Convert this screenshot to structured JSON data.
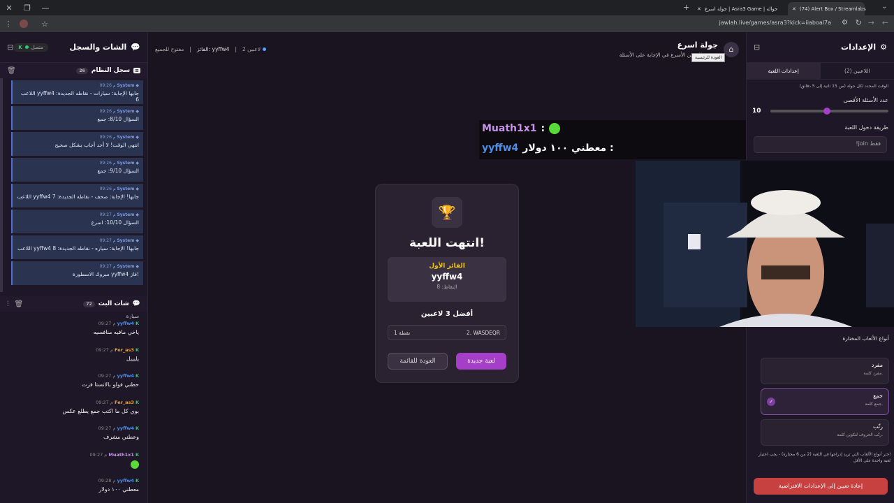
{
  "browser": {
    "tabs": [
      {
        "title": "(74) Alert Box / Streamlabs"
      },
      {
        "title": "جولة اسرع | Asra3 Game | جواله"
      }
    ],
    "url": "jawlah.live/games/asra3?kick=iiaboal7a"
  },
  "chat_panel": {
    "title": "الشات والسجل",
    "status": "متصل",
    "system_log": {
      "title": "سجل النظام",
      "count": "26",
      "items": [
        {
          "sender": "System",
          "time": "09:26 م",
          "text": "اللاعب yyffw4 جابها الإجابة: سيارات - نقاطه الجديدة: 6"
        },
        {
          "sender": "System",
          "time": "09:26 م",
          "text": "السؤال 8/10: جمع"
        },
        {
          "sender": "System",
          "time": "09:26 م",
          "text": "انتهى الوقت! لا أحد أجاب بشكل صحيح"
        },
        {
          "sender": "System",
          "time": "09:26 م",
          "text": "السؤال 9/10: جمع"
        },
        {
          "sender": "System",
          "time": "09:26 م",
          "text": "اللاعب yyffw4 جابها! الإجابة: صحف - نقاطه الجديدة: 7"
        },
        {
          "sender": "System",
          "time": "09:27 م",
          "text": "السؤال 10/10: اسرع"
        },
        {
          "sender": "System",
          "time": "09:27 م",
          "text": "اللاعب yyffw4 جابها! الإجابة: سياره - نقاطه الجديدة: 8"
        },
        {
          "sender": "System",
          "time": "09:27 م",
          "text": "مبروك الاسطورة yyffw4 فاز!"
        }
      ]
    },
    "live_chat": {
      "title": "شات البث",
      "count": "72",
      "top_fragment": "سيارة",
      "messages": [
        {
          "user": "yyffw4",
          "time": "09:27 م",
          "text": "ياخي مافيه منافسيه",
          "color": "#4d8fe8"
        },
        {
          "user": "Fer_as3",
          "time": "09:27 م",
          "text": "يلبيبل",
          "color": "#e8a33a"
        },
        {
          "user": "yyffw4",
          "time": "09:27 م",
          "text": "حطني فولو بالانستا فزت",
          "color": "#4d8fe8"
        },
        {
          "user": "Fer_as3",
          "time": "09:27 م",
          "text": "بوي كل ما اكتب جمع يطلع عكس",
          "color": "#e8a33a"
        },
        {
          "user": "yyffw4",
          "time": "09:27 م",
          "text": "وعطني مشرف",
          "color": "#4d8fe8"
        },
        {
          "user": "Muath1x1",
          "time": "09:27 م",
          "text": "",
          "color": "#c792ea"
        },
        {
          "user": "yyffw4",
          "time": "09:28 م",
          "text": "معطني ١٠٠ دولار",
          "color": "#4d8fe8"
        }
      ]
    }
  },
  "game_header": {
    "title": "جولة اسرع",
    "subtitle": "وتحدي للاعبين الأسرع في الإجابة على الأسئلة",
    "home_tooltip": "العودة للرئيسية",
    "players_count": "2 لاعبين",
    "winner_label": "الفائز: yyffw4",
    "join_status": "مفتوح للجميع"
  },
  "result_card": {
    "title": "انتهت اللعبة!",
    "first_place_label": "الفائز الأول",
    "winner_name": "yyffw4",
    "winner_points": "النقاط: 8",
    "top3_title": "أفضل 3 لاعبين",
    "top3": [
      {
        "rank_name": "2. WASDEQR",
        "points": "1 نقطة"
      }
    ],
    "new_game_button": "لعبة جديدة",
    "back_button": "العودة للقائمة"
  },
  "stream_overlay": {
    "line1_user": "Muath1x1",
    "line2_text": "معطني ١٠٠ دولار :",
    "line2_user": "yyffw4"
  },
  "settings": {
    "title": "الإعدادات",
    "tooltip": "العودة للرئيسية",
    "tabs": [
      "إعدادات اللعبة",
      "اللاعبين (2)"
    ],
    "time_hint": "الوقت المحدد لكل جولة (من 15 ثانية إلى 5 دقائق)",
    "max_questions_label": "عدد الأسئلة الأقصى",
    "max_questions_value": "10",
    "max_questions_fraction": 0.48,
    "join_method_label": "طريقة دخول اللعبة",
    "join_method_value": "!join فقط",
    "game_types_title": "أنواع الألعاب المختارة",
    "game_types": [
      {
        "name": "مفرد",
        "desc": "مفرد كلمة.",
        "selected": false
      },
      {
        "name": "جمع",
        "desc": "جمع كلمة.",
        "selected": true
      },
      {
        "name": "رتّب",
        "desc": "رتّب الحروف لتكوين كلمة.",
        "selected": false
      }
    ],
    "types_hint": "اختر أنواع الألعاب التي تريد إدراجها في اللعبة (2 من 6 مختارة) - يجب اختيار لعبة واحدة على الأقل",
    "reset_button": "إعادة تعيين إلى الإعدادات الافتراضية"
  }
}
